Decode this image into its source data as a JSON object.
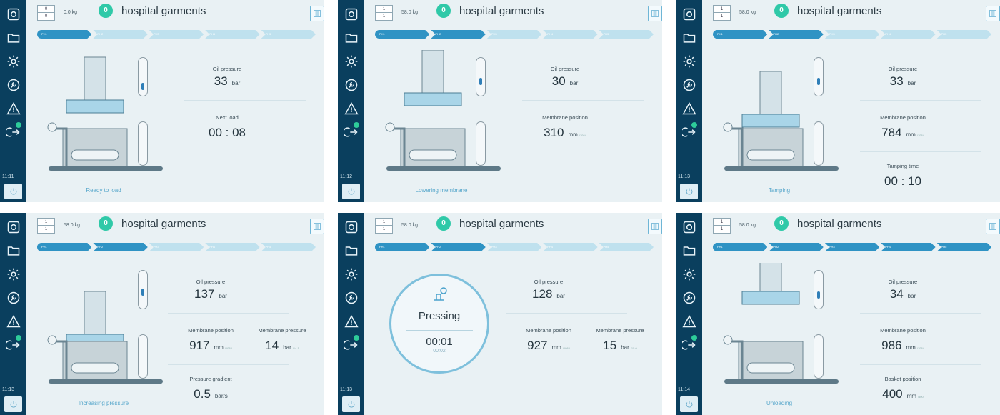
{
  "program": "hospital garments",
  "badge": "0",
  "phases": [
    "PH1",
    "PH2",
    "PH3",
    "PH4",
    "PH5"
  ],
  "units": {
    "bar": "bar",
    "mm": "mm",
    "mm_sub": "/1084",
    "bar_s": "bar/s"
  },
  "panels": [
    {
      "id": "p1",
      "time": "11:11",
      "counter_top": "0",
      "counter_bottom": "0",
      "weight": "0.0 kg",
      "active_phase": 0,
      "status": "Ready to load",
      "m1_label": "Oil pressure",
      "m1_value": "33",
      "m2_label": "Next load",
      "m2_value": "00 : 08",
      "gauge_level": 0.0
    },
    {
      "id": "p2",
      "time": "11:12",
      "counter_top": "1",
      "counter_bottom": "1",
      "weight": "58.0 kg",
      "active_phase": 1,
      "status": "Lowering membrane",
      "m1_label": "Oil pressure",
      "m1_value": "30",
      "m2_label": "Membrane position",
      "m2_value": "310",
      "gauge_level": 0.25
    },
    {
      "id": "p3",
      "time": "11:13",
      "counter_top": "1",
      "counter_bottom": "1",
      "weight": "58.0 kg",
      "active_phase": 1,
      "status": "Tamping",
      "m1_label": "Oil pressure",
      "m1_value": "33",
      "m2_label": "Membrane position",
      "m2_value": "784",
      "m3_label": "Tamping time",
      "m3_value": "00 : 10",
      "gauge_level": 0.25
    },
    {
      "id": "p4",
      "time": "11:13",
      "counter_top": "1",
      "counter_bottom": "1",
      "weight": "58.0 kg",
      "active_phase": 1,
      "status": "Increasing pressure",
      "m1_label": "Oil pressure",
      "m1_value": "137",
      "m2_label": "Membrane position",
      "m2_value": "917",
      "m2b_label": "Membrane pressure",
      "m2b_value": "14",
      "m2b_sub": "/14.1",
      "m3_label": "Pressure gradient",
      "m3_value": "0.5",
      "gauge_level": 0.35
    },
    {
      "id": "p5",
      "time": "11:13",
      "counter_top": "1",
      "counter_bottom": "1",
      "weight": "58.0 kg",
      "active_phase": 1,
      "status": "",
      "pressing_title": "Pressing",
      "pressing_time": "00:01",
      "pressing_total": "00:02",
      "m1_label": "Oil pressure",
      "m1_value": "128",
      "m2_label": "Membrane position",
      "m2_value": "927",
      "m2b_label": "Membrane pressure",
      "m2b_value": "15",
      "m2b_sub": "/15.0",
      "gauge_level": 0.35
    },
    {
      "id": "p6",
      "time": "11:14",
      "counter_top": "1",
      "counter_bottom": "1",
      "weight": "58.0 kg",
      "active_phase": 4,
      "status": "Unloading",
      "m1_label": "Oil pressure",
      "m1_value": "34",
      "m2_label": "Membrane position",
      "m2_value": "986",
      "m3_label": "Basket position",
      "m3_value": "400",
      "m3_sub": "/400",
      "gauge_level": 0.2
    }
  ]
}
